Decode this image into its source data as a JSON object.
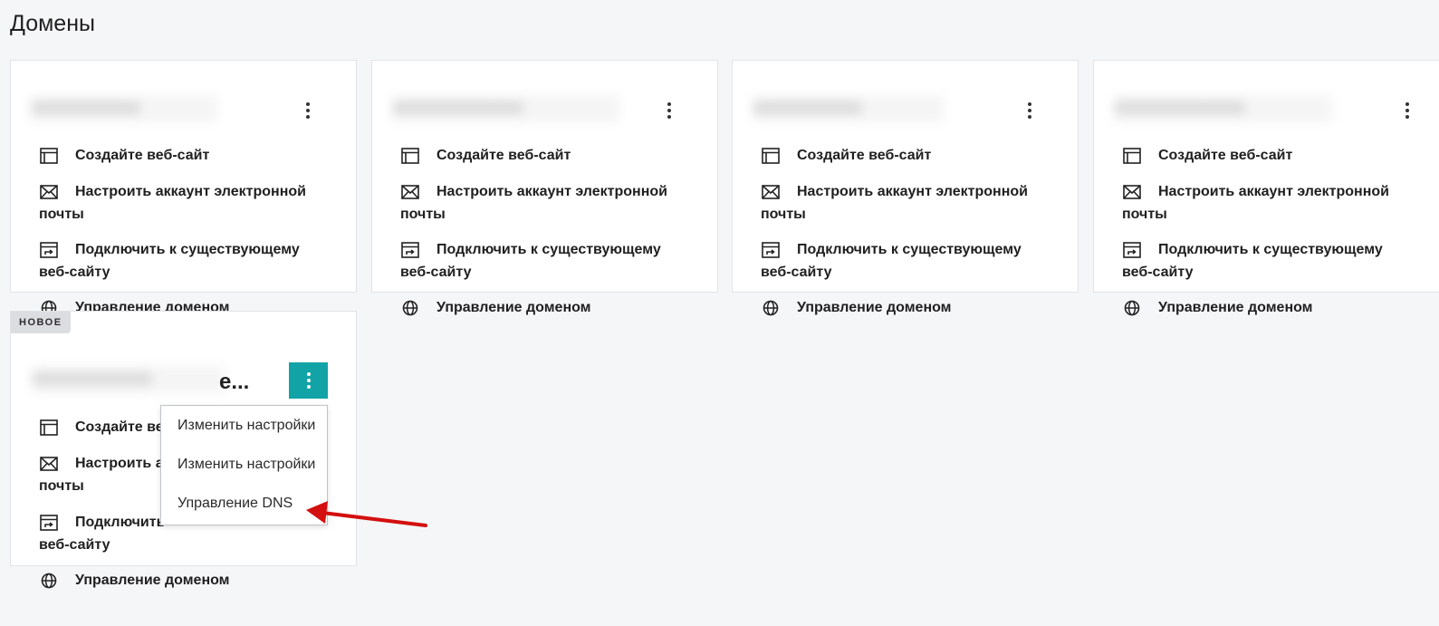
{
  "page": {
    "title": "Домены"
  },
  "actions": {
    "create_website": "Создайте веб-сайт",
    "setup_email_line1": "Настроить аккаунт электронной",
    "setup_email_line2": "почты",
    "connect_site_line1": "Подключить к существующему",
    "connect_site_line2": "веб-сайту",
    "manage_domain": "Управление доменом",
    "create_website_cut": "Создайте ве",
    "setup_email_cut": "Настроить а",
    "connect_site_cut": "Подключить"
  },
  "new_card": {
    "badge": "НОВОЕ",
    "name_suffix": "е..."
  },
  "dropdown": {
    "items": [
      "Изменить настройки",
      "Изменить настройки",
      "Управление DNS"
    ]
  },
  "colors": {
    "accent": "#11a3a6",
    "arrow": "#d40f0f",
    "background": "#f5f6f8"
  }
}
